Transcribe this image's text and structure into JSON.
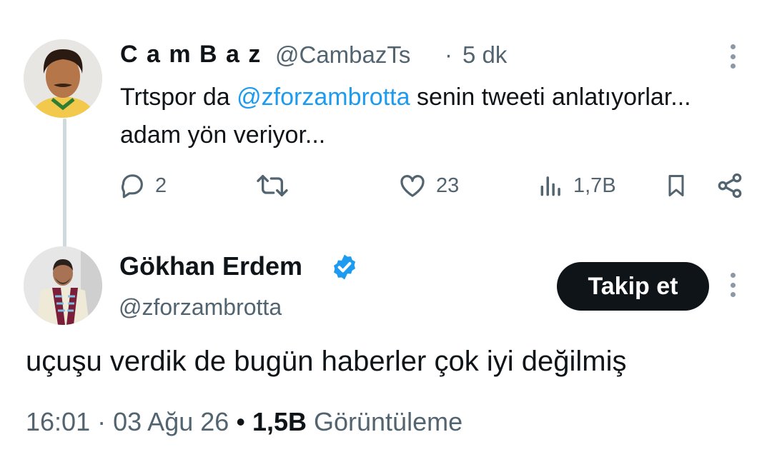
{
  "reply_tweet": {
    "display_name": "C a m B a z",
    "handle": "@CambazTs",
    "separator": "·",
    "time": "5 dk",
    "text_before": "Trtspor da ",
    "mention": "@zforzambrotta",
    "text_after": " senin tweeti anlatıyorlar... adam yön veriyor...",
    "actions": {
      "reply_count": "2",
      "retweet_count": "",
      "like_count": "23",
      "views_count": "1,7B"
    },
    "icons": [
      "reply-icon",
      "retweet-icon",
      "like-icon",
      "views-icon",
      "bookmark-icon",
      "share-icon",
      "more-icon"
    ]
  },
  "main_tweet": {
    "display_name": "Gökhan Erdem",
    "verified": true,
    "handle": "@zforzambrotta",
    "follow_label": "Takip et",
    "text": "uçuşu verdik de bugün haberler çok iyi değilmiş",
    "time": "16:01",
    "dot": "·",
    "date": "03 Ağu 26",
    "bullet": "•",
    "views_count": "1,5B",
    "views_label": "Görüntüleme"
  },
  "colors": {
    "text_primary": "#0f1419",
    "text_secondary": "#536471",
    "accent_blue": "#1d9bf0",
    "thread_line": "#cfd9de",
    "follow_button_bg": "#0f1419"
  }
}
